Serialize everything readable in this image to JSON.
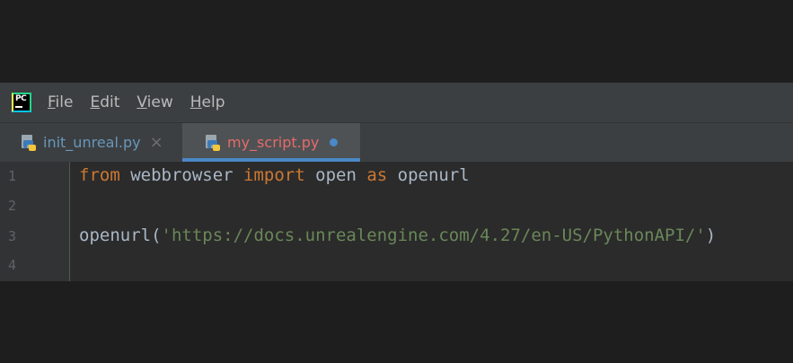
{
  "menu": {
    "items": [
      {
        "mnemonic": "F",
        "rest": "ile"
      },
      {
        "mnemonic": "E",
        "rest": "dit"
      },
      {
        "mnemonic": "V",
        "rest": "iew"
      },
      {
        "mnemonic": "H",
        "rest": "elp"
      }
    ],
    "logo_text": "PC"
  },
  "tabs": [
    {
      "label": "init_unreal.py",
      "close": "×",
      "active": false
    },
    {
      "label": "my_script.py",
      "active": true,
      "modified": true
    }
  ],
  "editor": {
    "line_numbers": [
      "1",
      "2",
      "3",
      "4"
    ],
    "lines": [
      {
        "kw1": "from",
        "mod": " webbrowser ",
        "kw2": "import",
        "name": " open ",
        "kw3": "as",
        "alias": " openurl"
      },
      {},
      {
        "func": "openurl(",
        "string": "'https://docs.unrealengine.com/4.27/en-US/PythonAPI/'",
        "close": ")"
      },
      {}
    ]
  },
  "colors": {
    "keyword": "#cc7832",
    "string": "#6a8759",
    "identifier": "#a9b7c6",
    "active_tab_underline": "#4a88c7"
  }
}
